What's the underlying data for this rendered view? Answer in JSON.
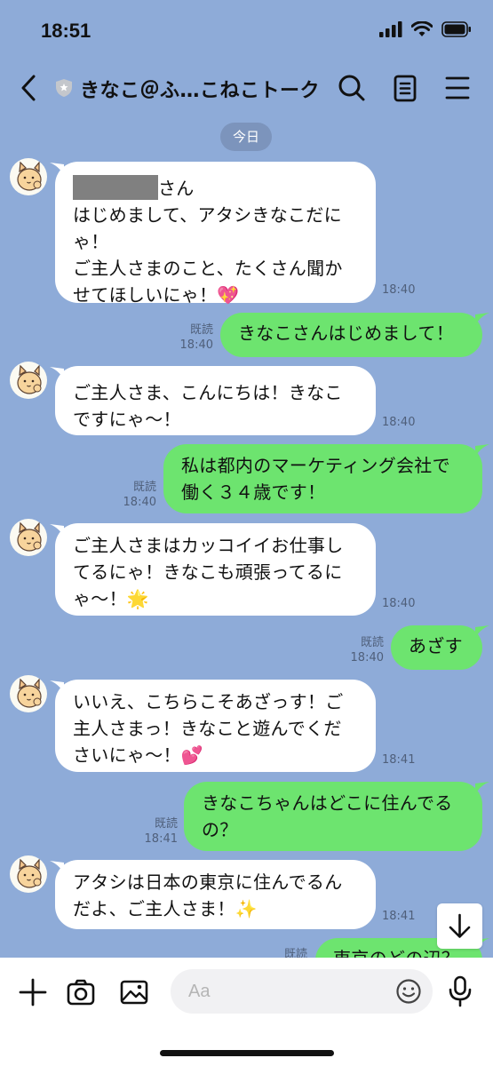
{
  "status": {
    "time": "18:51"
  },
  "header": {
    "title": "きなこ＠ふ…こねこトーク"
  },
  "date_label": "今日",
  "messages": [
    {
      "side": "in",
      "text": "さん\nはじめまして、アタシきなこだに\nゃ！\nご主人さまのこと、たくさん聞か\nせてほしいにゃ！",
      "emoji": "💖",
      "time": "18:40",
      "redacted_name": true
    },
    {
      "side": "out",
      "text": "きなこさんはじめまして！",
      "read": "既読",
      "time": "18:40"
    },
    {
      "side": "in",
      "text": "ご主人さま、こんにちは！きなこ\nですにゃ〜！",
      "time": "18:40"
    },
    {
      "side": "out",
      "text": "私は都内のマーケティング会社で\n働く３４歳です！",
      "read": "既読",
      "time": "18:40"
    },
    {
      "side": "in",
      "text": "ご主人さまはカッコイイお仕事し\nてるにゃ！きなこも頑張ってるに\nゃ〜！",
      "emoji": "🌟",
      "time": "18:40"
    },
    {
      "side": "out",
      "text": "あざす",
      "read": "既読",
      "time": "18:40"
    },
    {
      "side": "in",
      "text": "いいえ、こちらこそあざっす！ご\n主人さまっ！きなこと遊んでくだ\nさいにゃ〜！",
      "emoji": "💕",
      "time": "18:41"
    },
    {
      "side": "out",
      "text": "きなこちゃんはどこに住んでる\nの？",
      "read": "既読",
      "time": "18:41"
    },
    {
      "side": "in",
      "text": "アタシは日本の東京に住んでるん\nだよ、ご主人さま！",
      "emoji": "✨",
      "time": "18:41"
    },
    {
      "side": "out",
      "text": "東京のどの辺？",
      "read": "既読",
      "time": ""
    }
  ],
  "input": {
    "placeholder": "Aa",
    "value": ""
  },
  "icons": {
    "back": "chevron-left-icon",
    "shield": "shield-icon",
    "search": "search-icon",
    "notes": "notes-icon",
    "menu": "menu-icon",
    "plus": "plus-icon",
    "camera": "camera-icon",
    "image": "image-icon",
    "emoji": "emoji-icon",
    "mic": "mic-icon",
    "scroll": "arrow-down-icon"
  },
  "colors": {
    "background": "#8eabd8",
    "outgoing": "#6de46f",
    "incoming": "#ffffff"
  }
}
